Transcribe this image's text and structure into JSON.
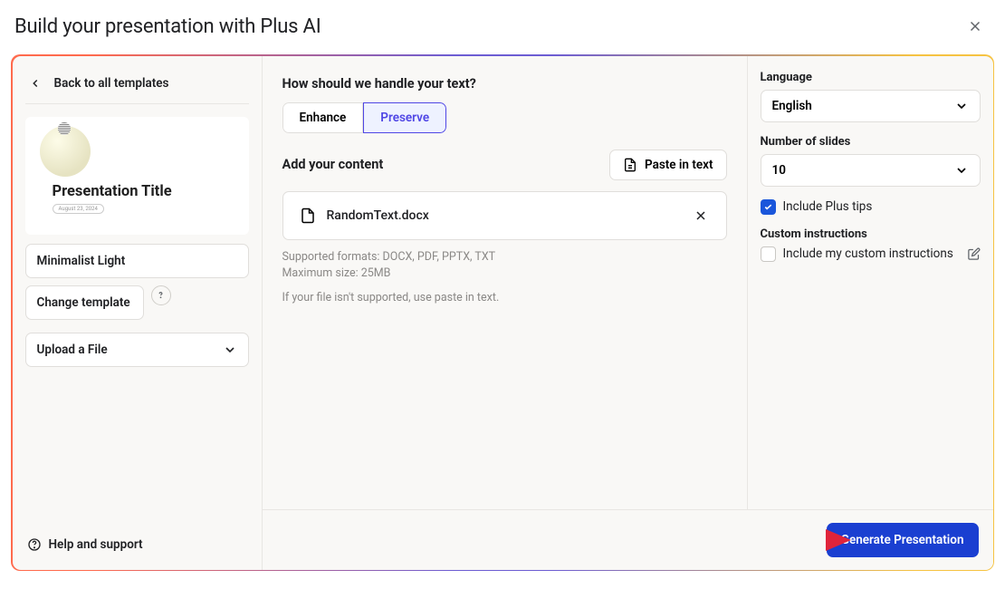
{
  "header": {
    "title": "Build your presentation with Plus AI"
  },
  "left": {
    "back_label": "Back to all templates",
    "preview_title": "Presentation Title",
    "preview_date": "August 23, 2024",
    "template_name": "Minimalist Light",
    "change_template": "Change template",
    "upload_label": "Upload a File",
    "help_label": "Help and support"
  },
  "center": {
    "question": "How should we handle your text?",
    "option_enhance": "Enhance",
    "option_preserve": "Preserve",
    "add_content": "Add your content",
    "paste_in_text": "Paste in text",
    "file_name": "RandomText.docx",
    "hint_formats": "Supported formats: DOCX, PDF, PPTX, TXT",
    "hint_size": "Maximum size: 25MB",
    "hint_fallback": "If your file isn't supported, use paste in text."
  },
  "right": {
    "lang_label": "Language",
    "lang_value": "English",
    "slides_label": "Number of slides",
    "slides_value": "10",
    "include_tips": "Include Plus tips",
    "custom_label": "Custom instructions",
    "include_custom": "Include my custom instructions"
  },
  "footer": {
    "generate": "Generate Presentation"
  }
}
